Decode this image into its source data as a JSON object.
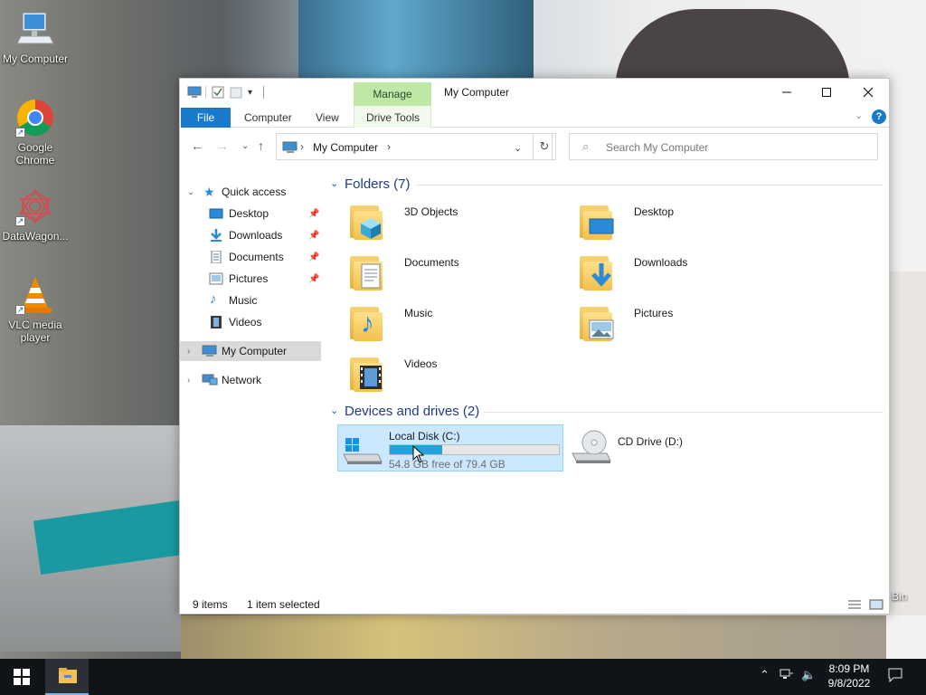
{
  "desktop": {
    "icons": [
      {
        "label": "My Computer",
        "icon": "computer-icon"
      },
      {
        "label": "Google Chrome",
        "icon": "chrome-icon"
      },
      {
        "label": "DataWagon...",
        "icon": "datawagon-icon"
      },
      {
        "label": "VLC media player",
        "icon": "vlc-icon"
      }
    ],
    "recycle_bin_partial": "Bin"
  },
  "window": {
    "title": "My Computer",
    "manage_tab": "Manage",
    "ribbon_tabs": [
      "File",
      "Computer",
      "View",
      "Drive Tools"
    ],
    "help_label": "?",
    "address": {
      "location": "My Computer"
    },
    "search": {
      "placeholder": "Search My Computer"
    }
  },
  "nav_pane": {
    "quick_access": "Quick access",
    "quick_items": [
      {
        "label": "Desktop",
        "pinned": true
      },
      {
        "label": "Downloads",
        "pinned": true
      },
      {
        "label": "Documents",
        "pinned": true
      },
      {
        "label": "Pictures",
        "pinned": true
      },
      {
        "label": "Music",
        "pinned": false
      },
      {
        "label": "Videos",
        "pinned": false
      }
    ],
    "my_computer": "My Computer",
    "network": "Network"
  },
  "content": {
    "folders_header": "Folders (7)",
    "folders": [
      {
        "label": "3D Objects",
        "icon": "3d-objects-folder-icon"
      },
      {
        "label": "Desktop",
        "icon": "desktop-folder-icon"
      },
      {
        "label": "Documents",
        "icon": "documents-folder-icon"
      },
      {
        "label": "Downloads",
        "icon": "downloads-folder-icon"
      },
      {
        "label": "Music",
        "icon": "music-folder-icon"
      },
      {
        "label": "Pictures",
        "icon": "pictures-folder-icon"
      },
      {
        "label": "Videos",
        "icon": "videos-folder-icon"
      }
    ],
    "devices_header": "Devices and drives (2)",
    "drives": [
      {
        "label": "Local Disk (C:)",
        "free": "54.8 GB free of 79.4 GB",
        "used_fraction": 0.31,
        "selected": true
      },
      {
        "label": "CD Drive (D:)",
        "selected": false
      }
    ]
  },
  "status_bar": {
    "items": "9 items",
    "selected": "1 item selected"
  },
  "taskbar": {
    "time": "8:09 PM",
    "date": "9/8/2022"
  },
  "colors": {
    "accent": "#1979ca",
    "manage_tab": "#bfe8a6",
    "selection": "#cce8ff",
    "drive_bar": "#26a0da",
    "taskbar": "#101418"
  }
}
